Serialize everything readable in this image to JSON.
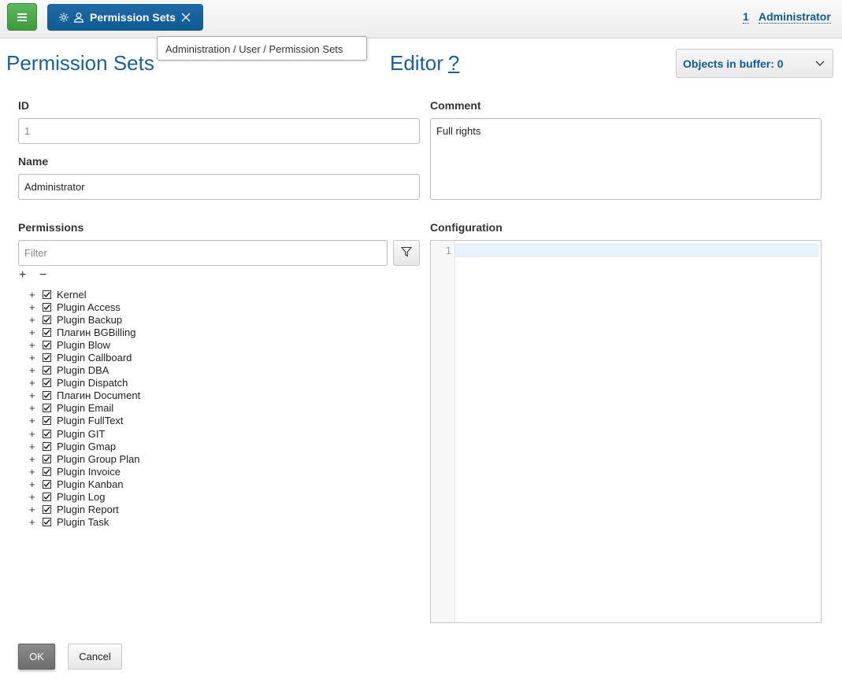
{
  "topbar": {
    "menu_icon": "hamburger-icon",
    "tab": {
      "label": "Permission Sets",
      "icons": [
        "gear-icon",
        "user-icon",
        "close-icon"
      ]
    },
    "user": {
      "id": "1",
      "name": "Administrator"
    }
  },
  "breadcrumb": "Administration / User / Permission Sets",
  "page_title": "Permission Sets",
  "editor_title": "Editor",
  "editor_help": "?",
  "buffer": {
    "label": "Objects in buffer: 0"
  },
  "form": {
    "id_label": "ID",
    "id_value": "1",
    "name_label": "Name",
    "name_value": "Administrator",
    "comment_label": "Comment",
    "comment_value": "Full rights",
    "permissions_label": "Permissions",
    "filter_placeholder": "Filter",
    "expand_all": "+",
    "collapse_all": "−",
    "configuration_label": "Configuration",
    "config_line_number": "1"
  },
  "permissions": [
    {
      "label": "Kernel",
      "checked": true
    },
    {
      "label": "Plugin Access",
      "checked": true
    },
    {
      "label": "Plugin Backup",
      "checked": true
    },
    {
      "label": "Плагин BGBilling",
      "checked": true
    },
    {
      "label": "Plugin Blow",
      "checked": true
    },
    {
      "label": "Plugin Callboard",
      "checked": true
    },
    {
      "label": "Plugin DBA",
      "checked": true
    },
    {
      "label": "Plugin Dispatch",
      "checked": true
    },
    {
      "label": "Плагин Document",
      "checked": true
    },
    {
      "label": "Plugin Email",
      "checked": true
    },
    {
      "label": "Plugin FullText",
      "checked": true
    },
    {
      "label": "Plugin GIT",
      "checked": true
    },
    {
      "label": "Plugin Gmap",
      "checked": true
    },
    {
      "label": "Plugin Group Plan",
      "checked": true
    },
    {
      "label": "Plugin Invoice",
      "checked": true
    },
    {
      "label": "Plugin Kanban",
      "checked": true
    },
    {
      "label": "Plugin Log",
      "checked": true
    },
    {
      "label": "Plugin Report",
      "checked": true
    },
    {
      "label": "Plugin Task",
      "checked": true
    }
  ],
  "buttons": {
    "ok": "OK",
    "cancel": "Cancel"
  },
  "colors": {
    "accent": "#0f5a93",
    "menu_green": "#4cae4c",
    "title_blue": "#1a5f9e"
  }
}
